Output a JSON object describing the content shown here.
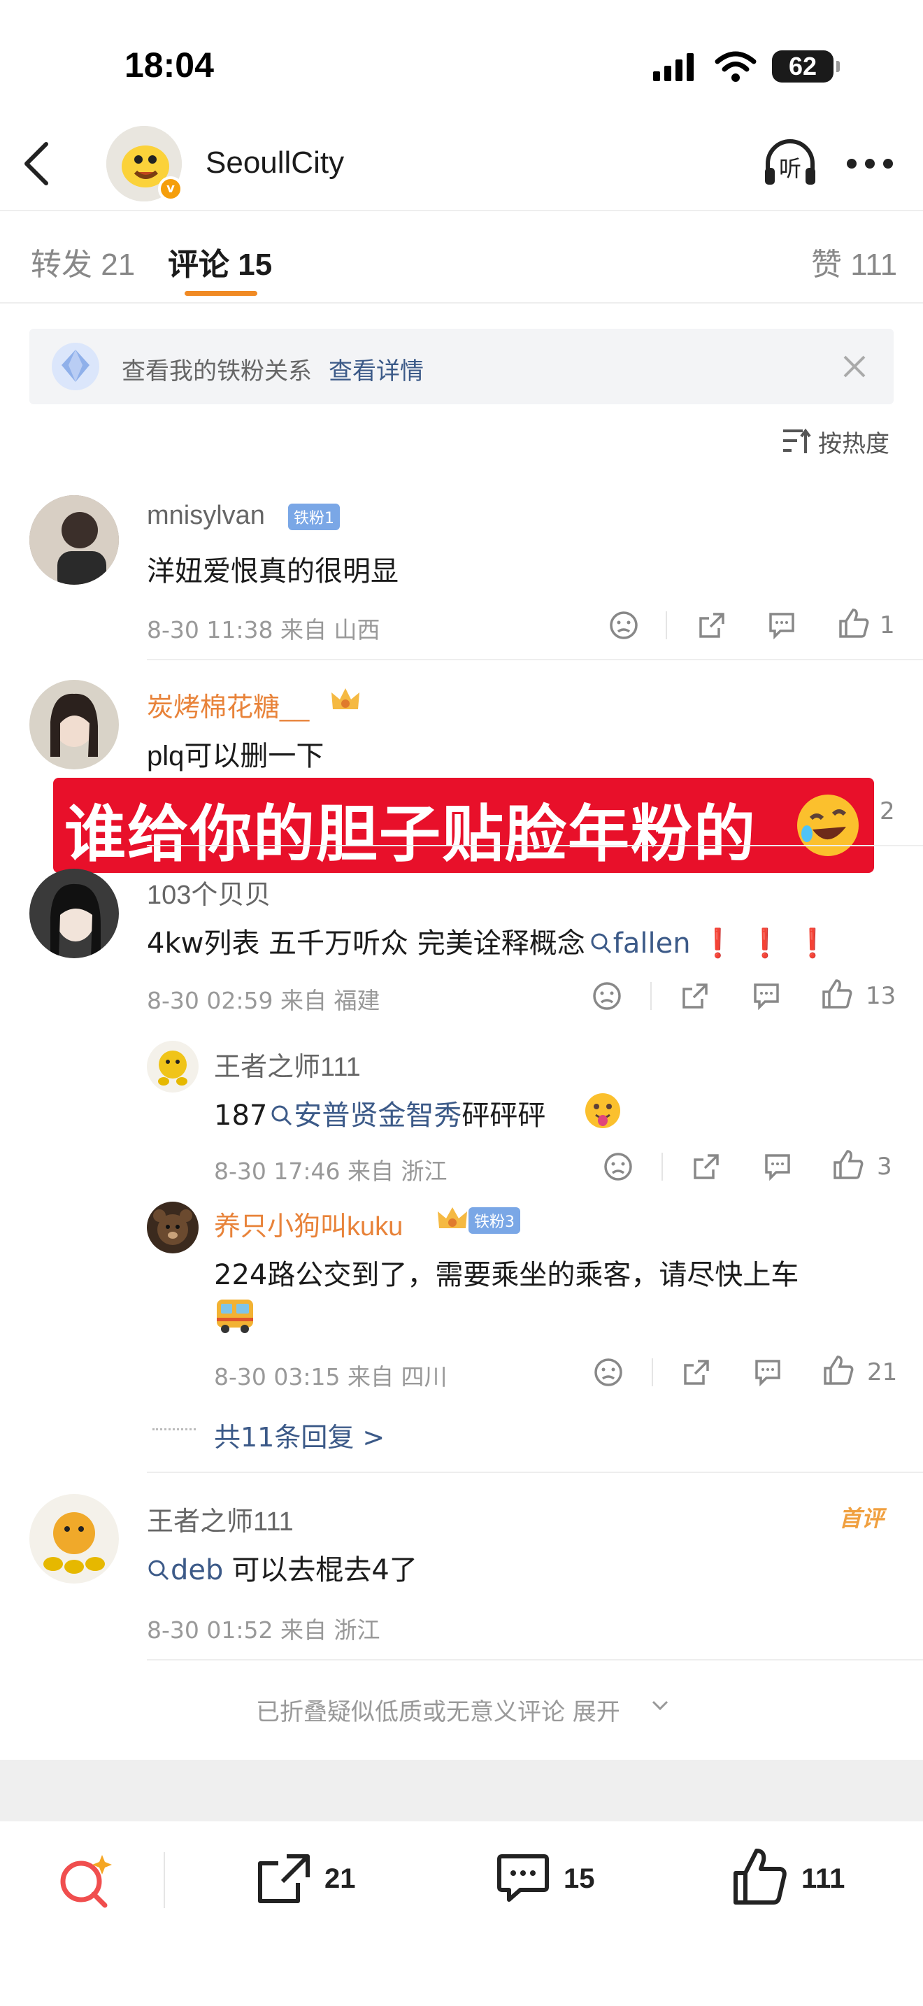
{
  "status_bar": {
    "time": "18:04",
    "battery": "62"
  },
  "nav": {
    "title": "SeoullCity",
    "listen_label": "听"
  },
  "tabs": {
    "repost": "转发 21",
    "comments": "评论 15",
    "likes": "赞 111"
  },
  "banner": {
    "text": "查看我的铁粉关系",
    "link": "查看详情"
  },
  "sort": {
    "label": "按热度"
  },
  "overlay": {
    "text": "谁给你的胆子贴脸年粉的"
  },
  "comments": [
    {
      "user": "mnisylvan",
      "badge": "铁粉1",
      "text": "洋妞爱恨真的很明显",
      "meta": "8-30 11:38 来自 山西",
      "likes": "1"
    },
    {
      "user": "炭烤棉花糖__",
      "text": "plq可以删一下",
      "likes": "2"
    },
    {
      "user": "103个贝贝",
      "text_prefix": "4kw列表 五千万听众 完美诠释概念",
      "link": "fallen",
      "text_suffix": "❗❗❗",
      "meta": "8-30 02:59 来自 福建",
      "likes": "13",
      "replies": [
        {
          "user": "王者之师111",
          "text_prefix": "187",
          "link": "安普贤金智秀",
          "text_suffix": "砰砰砰",
          "meta": "8-30 17:46 来自 浙江",
          "likes": "3"
        },
        {
          "user": "养只小狗叫kuku",
          "badge": "铁粉3",
          "text": "224路公交到了，需要乘坐的乘客，请尽快上车",
          "meta": "8-30 03:15 来自 四川",
          "likes": "21"
        }
      ],
      "more_replies": "共11条回复 >"
    },
    {
      "user": "王者之师111",
      "tag": "首评",
      "link": "deb",
      "text_suffix": "可以去棍去4了",
      "meta": "8-30 01:52 来自 浙江"
    }
  ],
  "folded": "已折叠疑似低质或无意义评论 展开",
  "bottom_bar": {
    "reposts": "21",
    "comments": "15",
    "likes": "111"
  },
  "colors": {
    "accent": "#f08a24",
    "link": "#3c5a88",
    "overlay": "#e8102a",
    "username_orange": "#e8833a"
  }
}
